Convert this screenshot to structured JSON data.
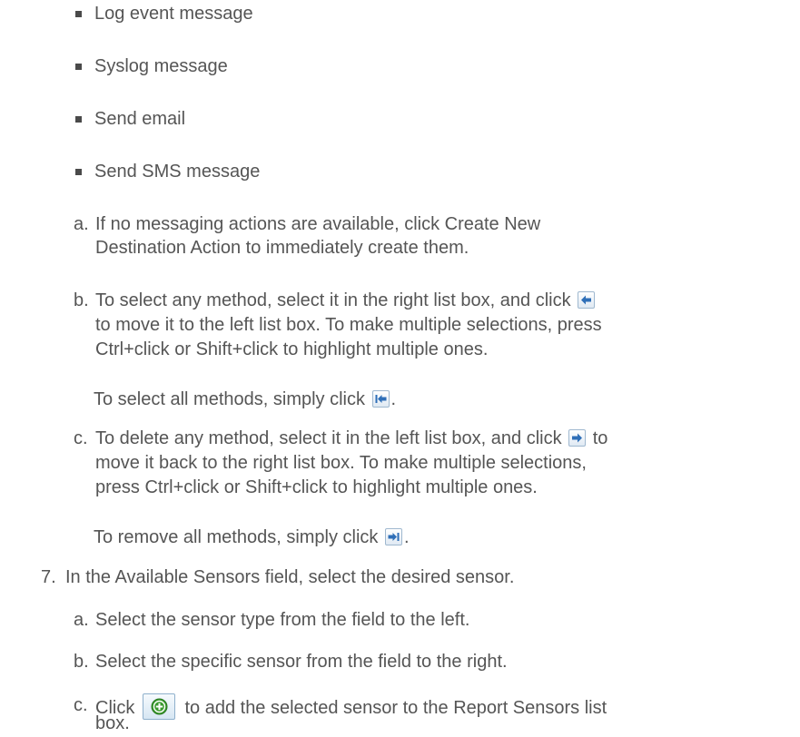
{
  "bullets": [
    "Log event message",
    "Syslog message",
    "Send email",
    "Send SMS message"
  ],
  "sub_steps_6": [
    {
      "marker": "a.",
      "lines": [
        "If no messaging actions are available, click Create New",
        "Destination Action to immediately create them."
      ]
    },
    {
      "marker": "b.",
      "line1_before_icon": "To select any method, select it in the right list box, and click",
      "line2": "to move it to the left list box. To make multiple selections, press",
      "line3": "Ctrl+click or Shift+click to highlight multiple ones.",
      "note_before_icon": "To select all methods, simply click",
      "note_after_icon": "."
    },
    {
      "marker": "c.",
      "line1_before_icon": "To delete any method, select it in the left list box, and click",
      "line1_after_icon": "to",
      "line2": "move it back to the right list box. To make multiple selections,",
      "line3": "press Ctrl+click or Shift+click to highlight multiple ones.",
      "note_before_icon": "To remove all methods, simply click",
      "note_after_icon": "."
    }
  ],
  "step7": {
    "marker": "7.",
    "text": "In the Available Sensors field, select the desired sensor.",
    "sub_steps": [
      {
        "marker": "a.",
        "text": "Select the sensor type from the field to the left."
      },
      {
        "marker": "b.",
        "text": "Select the specific sensor from the field to the right."
      },
      {
        "marker": "c.",
        "before_icon": "Click",
        "after_icon": "to add the selected sensor to the Report Sensors list",
        "line2": "box."
      }
    ]
  },
  "colors": {
    "text": "#555555",
    "icon_blue": "#2f6fb8",
    "icon_green": "#3a9a2e"
  }
}
